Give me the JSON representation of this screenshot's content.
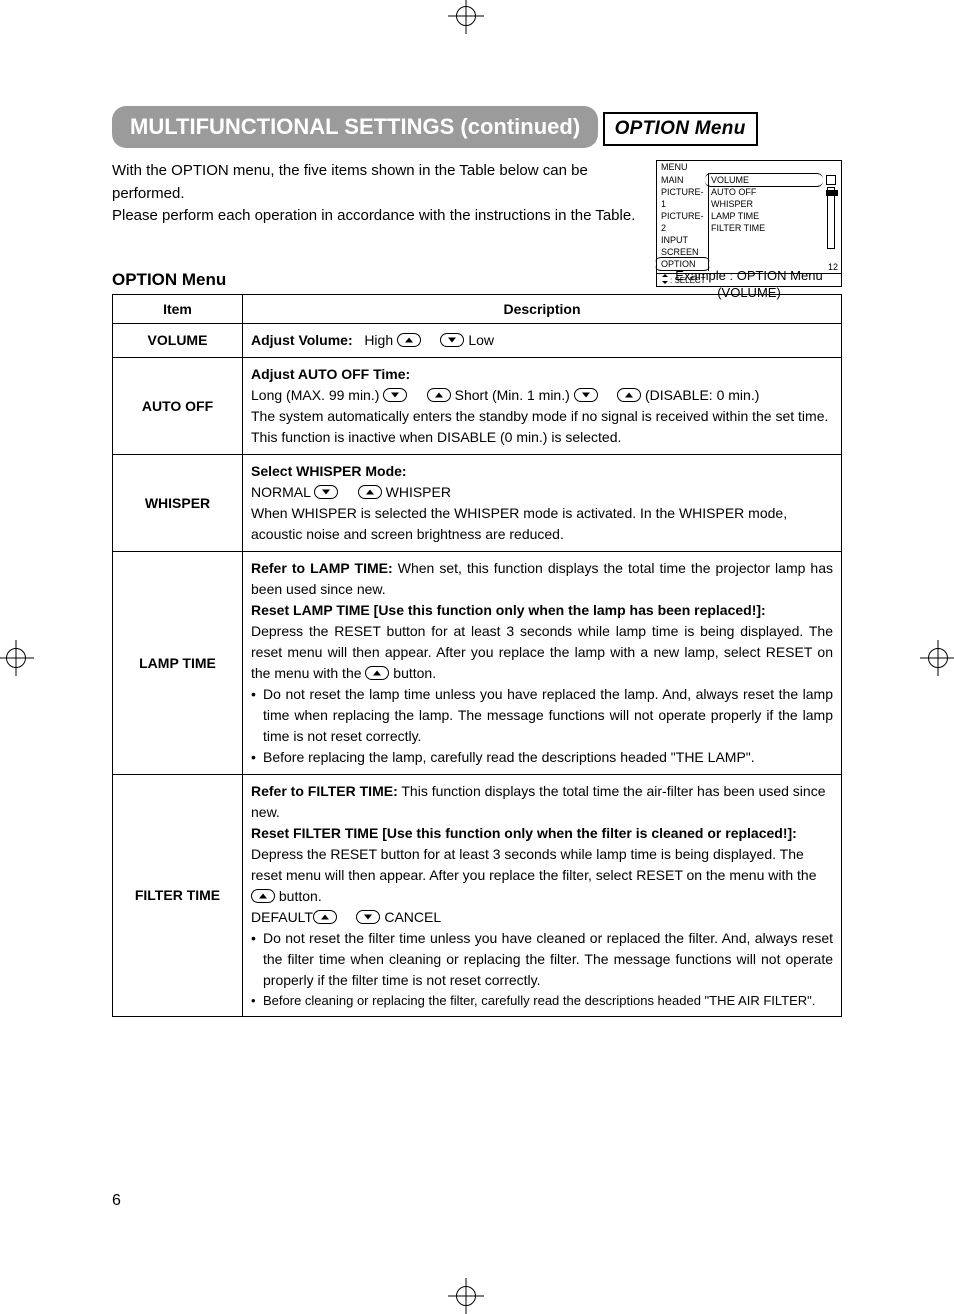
{
  "banner": "MULTIFUNCTIONAL SETTINGS (continued)",
  "subhead": "OPTION Menu",
  "intro": {
    "p1": "With the OPTION menu, the five items shown in the Table below can be performed.",
    "p2": "Please perform each operation in accordance with the instructions in the Table."
  },
  "osd": {
    "title": "MENU",
    "left": [
      "MAIN",
      "PICTURE-1",
      "PICTURE-2",
      "INPUT",
      "SCREEN",
      "OPTION"
    ],
    "right": [
      "VOLUME",
      "AUTO OFF",
      "WHISPER",
      "LAMP TIME",
      "FILTER TIME"
    ],
    "value": "12",
    "select": ": SELECT"
  },
  "menu_caption": {
    "l1": "Example : OPTION Menu",
    "l2": "(VOLUME)"
  },
  "table_title": "OPTION Menu",
  "headers": {
    "item": "Item",
    "desc": "Description"
  },
  "rows": {
    "volume": {
      "item": "VOLUME",
      "lead": "Adjust Volume:",
      "high": "High",
      "low": "Low"
    },
    "autooff": {
      "item": "AUTO OFF",
      "lead": "Adjust AUTO OFF Time:",
      "long": "Long (MAX. 99 min.)",
      "short": "Short (Min. 1 min.)",
      "disable": "(DISABLE: 0 min.)",
      "body": "The system automatically enters the standby mode if no signal is received within the set time. This function is inactive when DISABLE (0 min.) is selected."
    },
    "whisper": {
      "item": "WHISPER",
      "lead": "Select WHISPER Mode:",
      "normal": "NORMAL",
      "whisper": "WHISPER",
      "body": "When WHISPER is selected  the WHISPER mode is activated. In the WHISPER mode, acoustic noise and screen brightness are reduced."
    },
    "lamp": {
      "item": "LAMP TIME",
      "lead1": "Refer to LAMP TIME:",
      "body1": "When set, this function displays the total time the projector lamp has been used since new.",
      "lead2": "Reset LAMP TIME  [Use this function only when the lamp has been replaced!]:",
      "body2a": "Depress the RESET button for at least 3 seconds while lamp time is being displayed. The reset menu will then appear. After you replace the lamp with a new lamp, select RESET on the menu with the ",
      "body2b": " button.",
      "bul1": "Do not reset the lamp time unless you have replaced the lamp. And, always reset the lamp time when replacing the lamp. The message functions will not operate properly if the lamp time is not reset correctly.",
      "bul2": "Before replacing the lamp, carefully read the descriptions headed \"THE LAMP\"."
    },
    "filter": {
      "item": "FILTER TIME",
      "lead1": "Refer to FILTER TIME:",
      "body1": "This function displays the total time the air-filter has been used since new.",
      "lead2": "Reset FILTER TIME [Use this function only when the filter is cleaned or replaced!]:",
      "body2a": "Depress the RESET button for at least 3 seconds while lamp time is being displayed. The reset menu will then appear. After you replace the filter, select RESET on the menu with the ",
      "body2b": " button.",
      "default": "DEFAULT",
      "cancel": "CANCEL",
      "bul1": "Do not reset the filter time unless you have cleaned or replaced the filter. And, always reset the filter time when cleaning or replacing the filter. The message functions will not operate properly if the filter time is not reset correctly.",
      "bul2": "Before cleaning or replacing the filter, carefully read the descriptions headed \"THE AIR FILTER\"."
    }
  },
  "page_number": "6"
}
